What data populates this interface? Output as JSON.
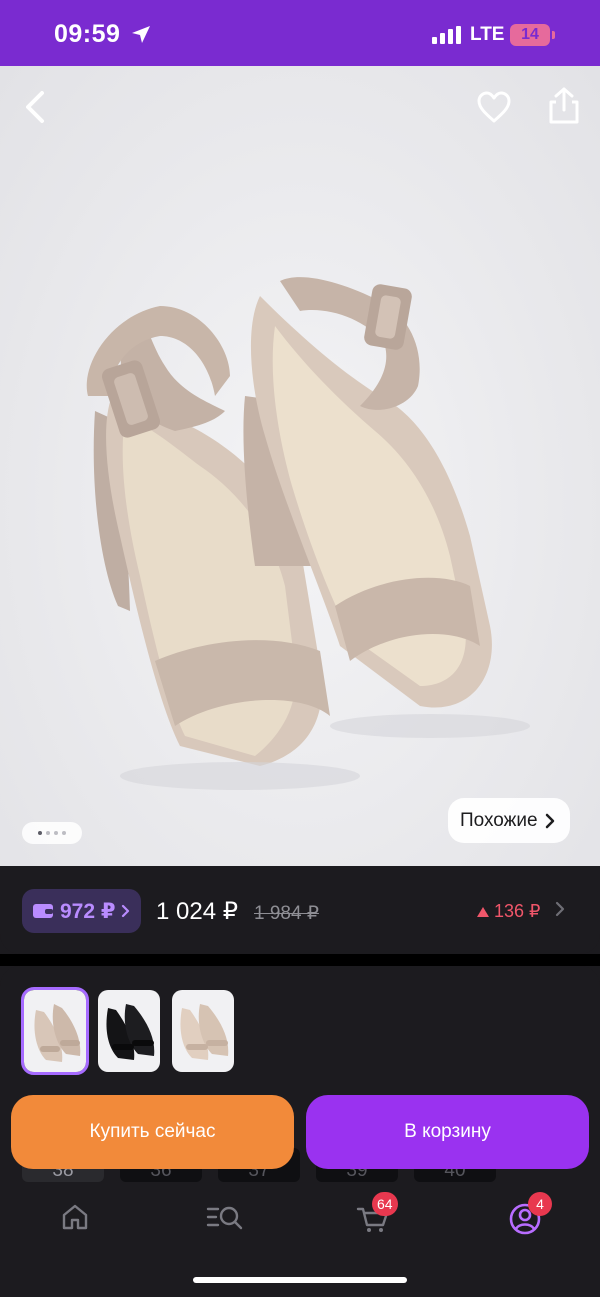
{
  "status_bar": {
    "time": "09:59",
    "network": "LTE",
    "battery": "14"
  },
  "product_photo": {
    "similar_label": "Похожие",
    "slides_total": 4,
    "slide_active": 1
  },
  "price_bar": {
    "wallet_price": "972 ₽",
    "price": "1 024 ₽",
    "old_price": "1 984 ₽",
    "delta": "136 ₽"
  },
  "variants": {
    "thumbnails": [
      {
        "color_name": "beige",
        "selected": true
      },
      {
        "color_name": "black",
        "selected": false
      },
      {
        "color_name": "beige",
        "selected": false
      }
    ],
    "sizes": [
      "38",
      "36",
      "37",
      "39",
      "40"
    ]
  },
  "actions": {
    "buy_now": "Купить сейчас",
    "add_to_cart": "В корзину"
  },
  "tab_bar": {
    "cart_badge": "64",
    "profile_badge": "4"
  },
  "colors": {
    "brand_purple": "#7a2bd0",
    "buy_orange": "#f28a3a",
    "cart_purple": "#9a32f0",
    "accent_red": "#e8384f"
  }
}
